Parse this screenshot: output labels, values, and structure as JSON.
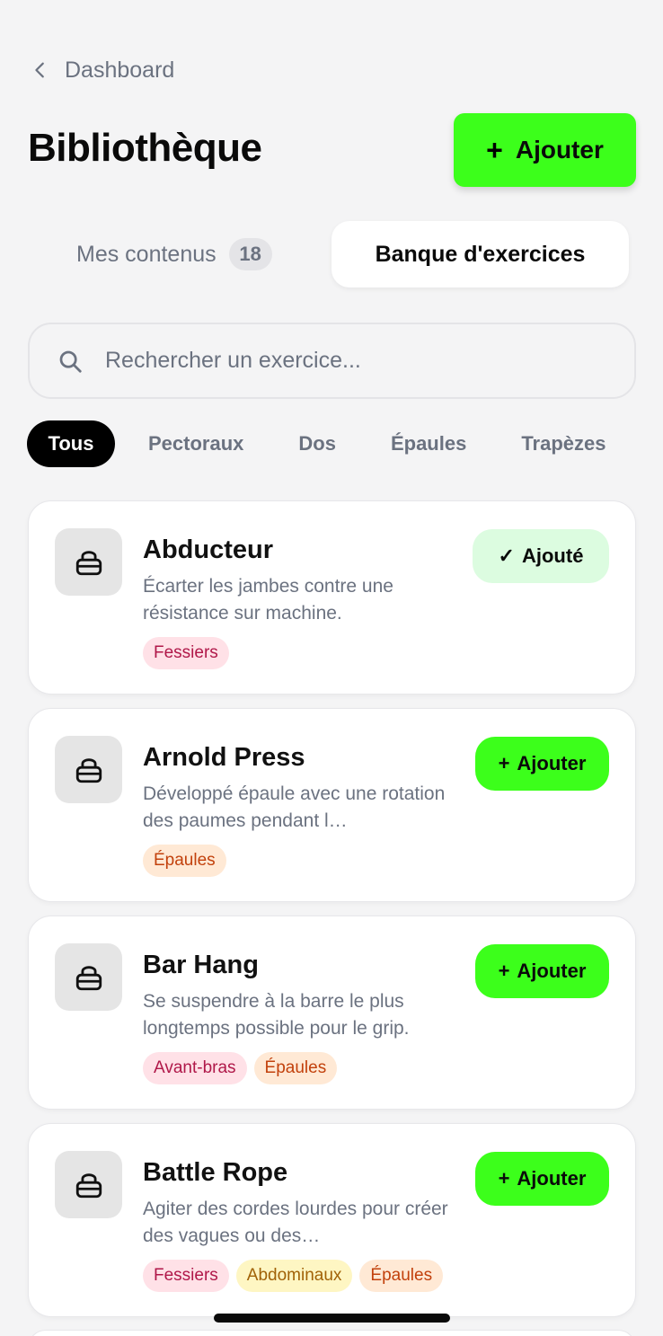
{
  "nav": {
    "back_label": "Dashboard"
  },
  "header": {
    "title": "Bibliothèque",
    "add_icon": "+",
    "add_label": "Ajouter"
  },
  "tabs": {
    "mine_label": "Mes contenus",
    "mine_count": "18",
    "bank_label": "Banque d'exercices",
    "active": "bank"
  },
  "search": {
    "placeholder": "Rechercher un exercice..."
  },
  "filters": [
    {
      "label": "Tous",
      "active": true
    },
    {
      "label": "Pectoraux",
      "active": false
    },
    {
      "label": "Dos",
      "active": false
    },
    {
      "label": "Épaules",
      "active": false
    },
    {
      "label": "Trapèzes",
      "active": false
    }
  ],
  "exercises": [
    {
      "name": "Abducteur",
      "description": "Écarter les jambes contre une résistance sur machine.",
      "tags": [
        {
          "label": "Fessiers",
          "color": "#ffe1e7"
        }
      ],
      "button_icon": "✓",
      "button_label": "Ajouté",
      "added": true
    },
    {
      "name": "Arnold Press",
      "description": "Développé épaule avec une rotation des paumes pendant l…",
      "tags": [
        {
          "label": "Épaules",
          "color": "#ffe9d5"
        }
      ],
      "button_icon": "+",
      "button_label": "Ajouter",
      "added": false
    },
    {
      "name": "Bar Hang",
      "description": "Se suspendre à la barre le plus longtemps possible pour le grip.",
      "tags": [
        {
          "label": "Avant-bras",
          "color": "#ffe1e7"
        },
        {
          "label": "Épaules",
          "color": "#ffe9d5"
        }
      ],
      "button_icon": "+",
      "button_label": "Ajouter",
      "added": false
    },
    {
      "name": "Battle Rope",
      "description": "Agiter des cordes lourdes pour créer des vagues ou des…",
      "tags": [
        {
          "label": "Fessiers",
          "color": "#ffe1e7"
        },
        {
          "label": "Abdominaux",
          "color": "#fef6c3"
        },
        {
          "label": "Épaules",
          "color": "#ffe9d5"
        }
      ],
      "button_icon": "+",
      "button_label": "Ajouter",
      "added": false
    }
  ],
  "colors": {
    "accent": "#3cff1b",
    "added_bg": "#dcfce0",
    "background": "#f4f4f5"
  },
  "icons": {
    "back": "chevron-left-icon",
    "search": "search-icon",
    "exercise": "weight-icon"
  }
}
